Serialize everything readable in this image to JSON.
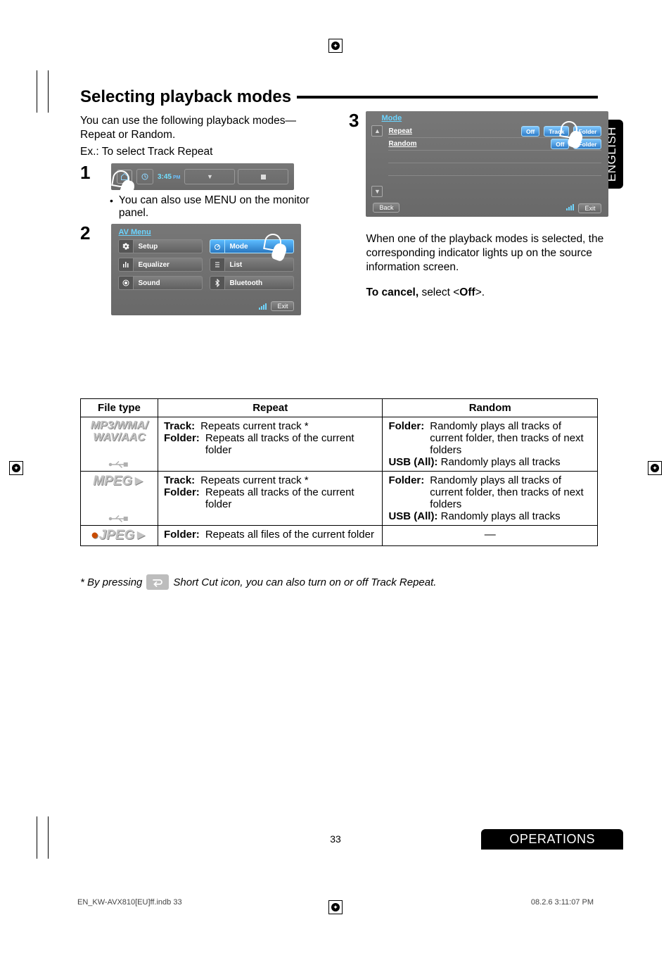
{
  "domain": "Document",
  "side_tab": "ENGLISH",
  "heading": "Selecting playback modes",
  "intro1": "You can use the following playback modes—Repeat or Random.",
  "intro2": "Ex.: To select Track Repeat",
  "steps": {
    "s1": "1",
    "s2": "2",
    "s3": "3"
  },
  "bullet_s1": "You can also use MENU on the monitor panel.",
  "note_right": "When one of the playback modes is selected, the corresponding indicator lights up on the source information screen.",
  "cancel_prefix": "To cancel, ",
  "cancel_mid": "select <",
  "cancel_bold": "Off",
  "cancel_suffix": ">.",
  "screen1": {
    "clock_time": "3:45",
    "clock_pm": "PM"
  },
  "screen2": {
    "title": "AV Menu",
    "items": [
      {
        "icon": "gear",
        "label": "Setup"
      },
      {
        "icon": "dial",
        "label": "Mode"
      },
      {
        "icon": "eq",
        "label": "Equalizer"
      },
      {
        "icon": "list",
        "label": "List"
      },
      {
        "icon": "spk",
        "label": "Sound"
      },
      {
        "icon": "bt",
        "label": "Bluetooth"
      }
    ],
    "exit": "Exit"
  },
  "screen3": {
    "title": "Mode",
    "rows": [
      {
        "name": "Repeat",
        "chips": [
          "Off",
          "Track",
          "Folder"
        ]
      },
      {
        "name": "Random",
        "chips": [
          "Off",
          "Folder"
        ]
      }
    ],
    "back": "Back",
    "exit": "Exit"
  },
  "table": {
    "headers": {
      "file": "File type",
      "repeat": "Repeat",
      "random": "Random"
    },
    "rows": [
      {
        "file_lines": [
          "MP3/WMA/",
          "WAV/AAC"
        ],
        "repeat": [
          {
            "k": "Track:",
            "v": "Repeats current track *"
          },
          {
            "k": "Folder:",
            "v": "Repeats all tracks of the current folder"
          }
        ],
        "random": [
          {
            "k": "Folder:",
            "v": "Randomly plays all tracks of current folder, then tracks of next folders"
          },
          {
            "k": "USB (All):",
            "v": " Randomly plays all tracks"
          }
        ]
      },
      {
        "file_lines": [
          "MPEG"
        ],
        "repeat": [
          {
            "k": "Track:",
            "v": "Repeats current track *"
          },
          {
            "k": "Folder:",
            "v": "Repeats all tracks of the current folder"
          }
        ],
        "random": [
          {
            "k": "Folder:",
            "v": "Randomly plays all tracks of current folder, then tracks of next folders"
          },
          {
            "k": "USB (All):",
            "v": " Randomly plays all tracks"
          }
        ],
        "video_arrow": true
      },
      {
        "file_lines": [
          "JPEG"
        ],
        "repeat": [
          {
            "k": "Folder:",
            "v": "Repeats all files of the current folder"
          }
        ],
        "random_na": "—",
        "video_arrow": true
      }
    ]
  },
  "footnote_pre": "*   By pressing ",
  "footnote_post": " Short Cut icon, you can also turn on or off Track Repeat.",
  "page_number": "33",
  "operations": "OPERATIONS",
  "print_left": "EN_KW-AVX810[EU]ff.indb   33",
  "print_right": "08.2.6   3:11:07 PM"
}
